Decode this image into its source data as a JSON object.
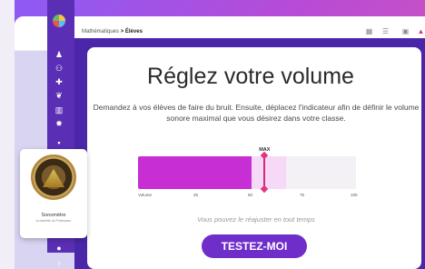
{
  "breadcrumb": {
    "parent": "Mathématiques",
    "separator": ">",
    "current": "Élèves"
  },
  "title": "Réglez votre volume",
  "description": "Demandez à vos élèves de faire du bruit. Ensuite, déplacez l'indicateur afin de définir le volume sonore maximal que vous désirez dans votre classe.",
  "meter": {
    "max_label": "MAX",
    "axis_label": "Volume",
    "ticks": [
      "25",
      "50",
      "75",
      "100"
    ],
    "current_level_percent": 52,
    "max_level_percent": 58
  },
  "hint": "Vous pouvez le réajuster en tout temps",
  "cta_label": "TESTEZ-MOI",
  "overlay": {
    "title": "Sonomètre",
    "subtitle": "La tablette du Professeur"
  },
  "colors": {
    "accent": "#6f2ec9",
    "meter_fill": "#c72fd4",
    "max_marker": "#e03580",
    "sidebar": "#5a2fb5"
  },
  "icons": {
    "sidebar": [
      "logo-icon",
      "person-icon",
      "group-icon",
      "puzzle-icon",
      "paw-icon",
      "chart-icon",
      "gear-icon",
      "chat-icon",
      "info-icon",
      "chevron-right-icon"
    ],
    "topbar": [
      "grid-icon",
      "list-icon",
      "apps-icon",
      "bell-icon"
    ]
  }
}
